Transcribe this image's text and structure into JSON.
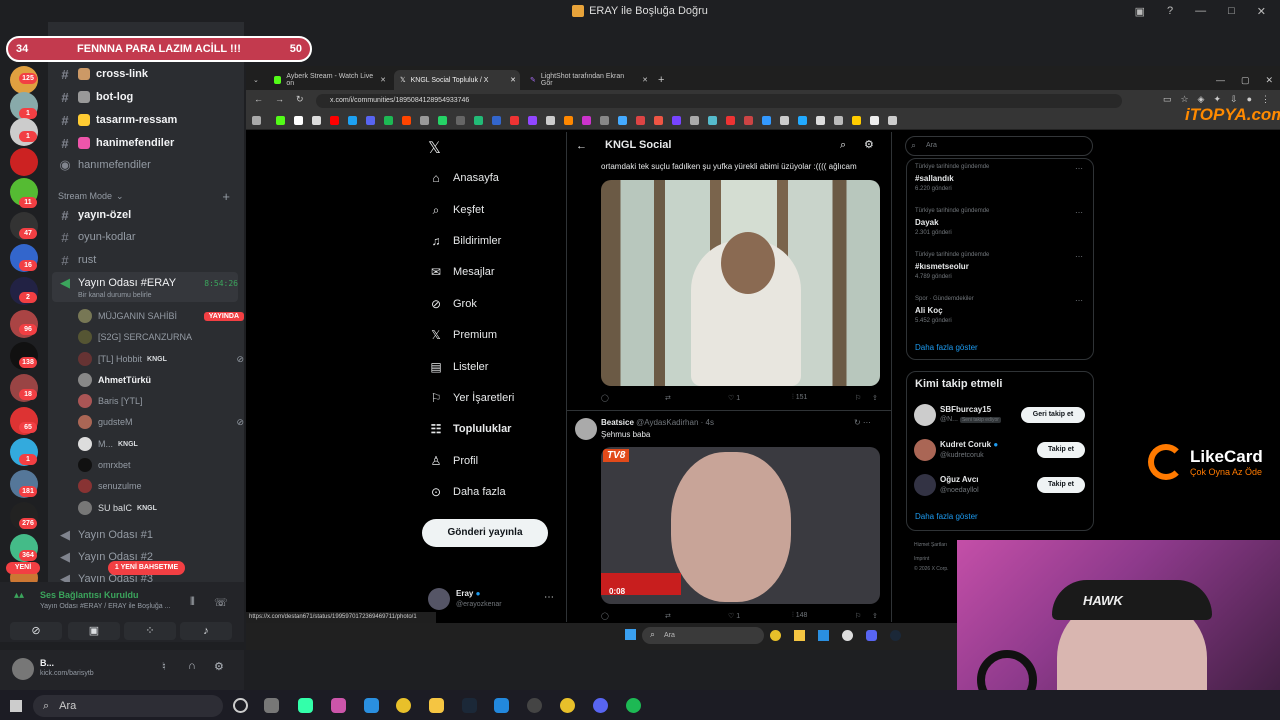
{
  "window": {
    "title": "ERAY ile Boşluğa Doğru"
  },
  "banner": {
    "left": "34",
    "text": "FENNNA PARA LAZIM ACİLL !!!",
    "right": "50"
  },
  "discord": {
    "server_badges": [
      "125",
      "1",
      "1",
      "11",
      "47",
      "16",
      "2",
      "96",
      "138",
      "18",
      "65",
      "1",
      "181",
      "276",
      "364"
    ],
    "new_badge": "YENİ",
    "new_event": "1 YENİ BAHSETME",
    "channels": [
      {
        "name": "cross-link"
      },
      {
        "name": "bot-log"
      },
      {
        "name": "tasarım-ressam"
      },
      {
        "name": "hanimefendiler"
      },
      {
        "name": "hanımefendiler"
      }
    ],
    "category": "Stream Mode",
    "stream_channels": [
      "yayın-özel",
      "oyun-kodlar",
      "rust"
    ],
    "voice_channel": {
      "name": "Yayın Odası #ERAY",
      "time": "8:54:26",
      "status": "Bir kanal durumu belirle"
    },
    "voice_users": [
      {
        "name": "MÜJGANIN SAHİBİ",
        "badge": "YAYINDA"
      },
      {
        "name": "[S2G] SERCANZURNA"
      },
      {
        "name": "[TL] Hobbit",
        "tag": "KNGL"
      },
      {
        "name": "AhmetTürkü"
      },
      {
        "name": "Baris [YTL]"
      },
      {
        "name": "gudsteM"
      },
      {
        "name": "M...",
        "tag": "KNGL"
      },
      {
        "name": "omrxbet"
      },
      {
        "name": "senuzulme"
      },
      {
        "name": "SU baIC",
        "tag": "KNGL"
      }
    ],
    "other_voice": [
      "Yayın Odası #1",
      "Yayın Odası #2",
      "Yayın Odası #3"
    ],
    "voice_status": {
      "title": "Ses Bağlantısı Kuruldu",
      "sub": "Yayın Odası #ERAY / ERAY ile Boşluğa ..."
    },
    "user": {
      "name": "B...",
      "sub": "kick.com/barisytb"
    }
  },
  "browser": {
    "tabs": [
      {
        "label": "Ayberk Stream - Watch Live on"
      },
      {
        "label": "KNGL Social Topluluk / X"
      },
      {
        "label": "LightShot tarafından Ekran Gör"
      }
    ],
    "url": "x.com/i/communities/1895084128954933746",
    "status_url": "https://x.com/destan671/status/1995970172369469711/photo/1",
    "watermark": "iTOPYA.com"
  },
  "x": {
    "nav": [
      "Anasayfa",
      "Keşfet",
      "Bildirimler",
      "Mesajlar",
      "Grok",
      "Premium",
      "Listeler",
      "Yer İşaretleri",
      "Topluluklar",
      "Profil",
      "Daha fazla"
    ],
    "post_button": "Gönderi yayınla",
    "account": {
      "name": "Eray",
      "handle": "@erayozkenar"
    },
    "community": "KNGL Social",
    "post1": {
      "text": "ortamdaki tek suçlu fadılken şu yufka yürekli abimi üzüyolar :(((( ağlıcam",
      "likes": "1",
      "views": "151"
    },
    "post2": {
      "author": "Beatsice",
      "handle": "@AydasKadirhan · 4s",
      "text": "Şehmus baba",
      "channel": "TV8",
      "duration": "0:08",
      "likes": "1",
      "views": "148"
    },
    "search_placeholder": "Ara",
    "trends": [
      {
        "meta": "Türkiye tarihinde gündemde",
        "name": "#sallandık",
        "count": "6.220 gönderi"
      },
      {
        "meta": "Türkiye tarihinde gündemde",
        "name": "Dayak",
        "count": "2.301 gönderi"
      },
      {
        "meta": "Türkiye tarihinde gündemde",
        "name": "#kısmetseolur",
        "count": "4.789 gönderi"
      },
      {
        "meta": "Spor · Gündemdekiler",
        "name": "Ali Koç",
        "count": "5.452 gönderi"
      }
    ],
    "show_more": "Daha fazla göster",
    "who_to_follow": "Kimi takip etmeli",
    "follow": [
      {
        "name": "SBFburcay15",
        "handle": "@N...",
        "note": "Seni takip ediyor",
        "button": "Geri takip et"
      },
      {
        "name": "Kudret Coruk",
        "handle": "@kudretcoruk",
        "button": "Takip et"
      },
      {
        "name": "Oğuz Avcı",
        "handle": "@noedayllol",
        "button": "Takip et"
      }
    ],
    "footer": [
      "Hizmet Şartları",
      "Imprint",
      "© 2026 X Corp."
    ]
  },
  "inner_taskbar": {
    "search": "Ara"
  },
  "overlay": {
    "likecard": "LikeCard",
    "likecard_sub": "Çok Oyna  Az Öde",
    "hawk": "HAWK"
  },
  "taskbar": {
    "search": "Ara"
  }
}
